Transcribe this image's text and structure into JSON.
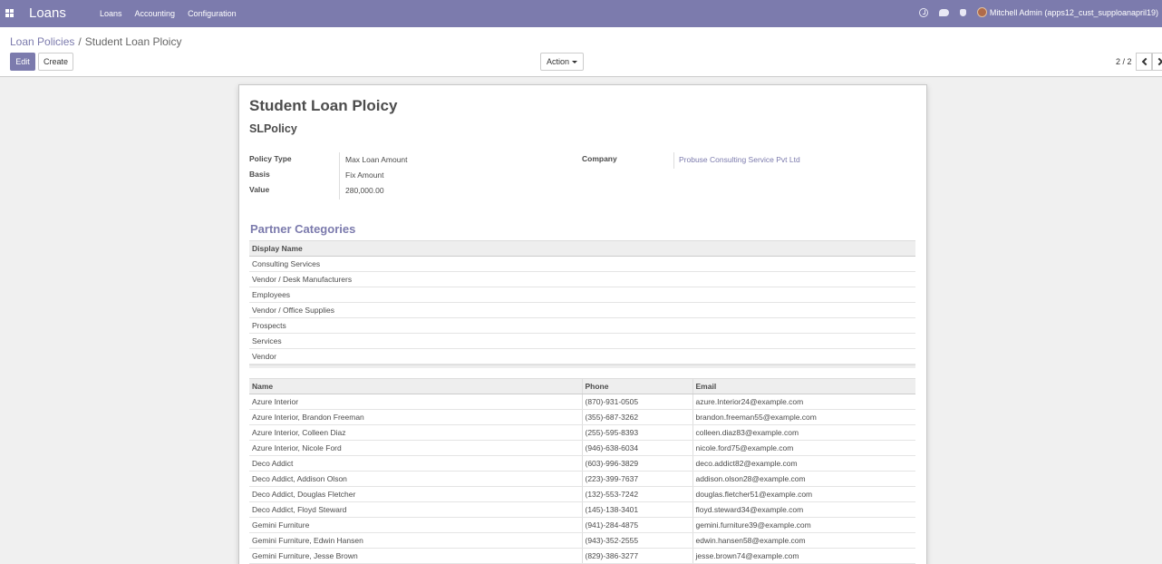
{
  "navbar": {
    "brand": "Loans",
    "menu": [
      "Loans",
      "Accounting",
      "Configuration"
    ],
    "user": "Mitchell Admin (apps12_cust_supploanapril19)"
  },
  "breadcrumb": {
    "parent": "Loan Policies",
    "separator": "/",
    "current": "Student Loan Ploicy"
  },
  "buttons": {
    "edit": "Edit",
    "create": "Create",
    "action": "Action"
  },
  "pager": {
    "value": "2 / 2"
  },
  "record": {
    "name": "Student Loan Ploicy",
    "code": "SLPolicy",
    "fields": {
      "policy_type_label": "Policy Type",
      "policy_type": "Max Loan Amount",
      "basis_label": "Basis",
      "basis": "Fix Amount",
      "value_label": "Value",
      "value": "280,000.00",
      "company_label": "Company",
      "company": "Probuse Consulting Service Pvt Ltd"
    }
  },
  "partner_categories": {
    "title": "Partner Categories",
    "header": "Display Name",
    "rows": [
      "Consulting Services",
      "Vendor / Desk Manufacturers",
      "Employees",
      "Vendor / Office Supplies",
      "Prospects",
      "Services",
      "Vendor"
    ]
  },
  "partners": {
    "headers": {
      "name": "Name",
      "phone": "Phone",
      "email": "Email"
    },
    "rows": [
      {
        "name": "Azure Interior",
        "phone": "(870)-931-0505",
        "email": "azure.Interior24@example.com"
      },
      {
        "name": "Azure Interior, Brandon Freeman",
        "phone": "(355)-687-3262",
        "email": "brandon.freeman55@example.com"
      },
      {
        "name": "Azure Interior, Colleen Diaz",
        "phone": "(255)-595-8393",
        "email": "colleen.diaz83@example.com"
      },
      {
        "name": "Azure Interior, Nicole Ford",
        "phone": "(946)-638-6034",
        "email": "nicole.ford75@example.com"
      },
      {
        "name": "Deco Addict",
        "phone": "(603)-996-3829",
        "email": "deco.addict82@example.com"
      },
      {
        "name": "Deco Addict, Addison Olson",
        "phone": "(223)-399-7637",
        "email": "addison.olson28@example.com"
      },
      {
        "name": "Deco Addict, Douglas Fletcher",
        "phone": "(132)-553-7242",
        "email": "douglas.fletcher51@example.com"
      },
      {
        "name": "Deco Addict, Floyd Steward",
        "phone": "(145)-138-3401",
        "email": "floyd.steward34@example.com"
      },
      {
        "name": "Gemini Furniture",
        "phone": "(941)-284-4875",
        "email": "gemini.furniture39@example.com"
      },
      {
        "name": "Gemini Furniture, Edwin Hansen",
        "phone": "(943)-352-2555",
        "email": "edwin.hansen58@example.com"
      },
      {
        "name": "Gemini Furniture, Jesse Brown",
        "phone": "(829)-386-3277",
        "email": "jesse.brown74@example.com"
      }
    ]
  },
  "colors": {
    "brand": "#7c7bad",
    "background": "#f0f0f0"
  }
}
